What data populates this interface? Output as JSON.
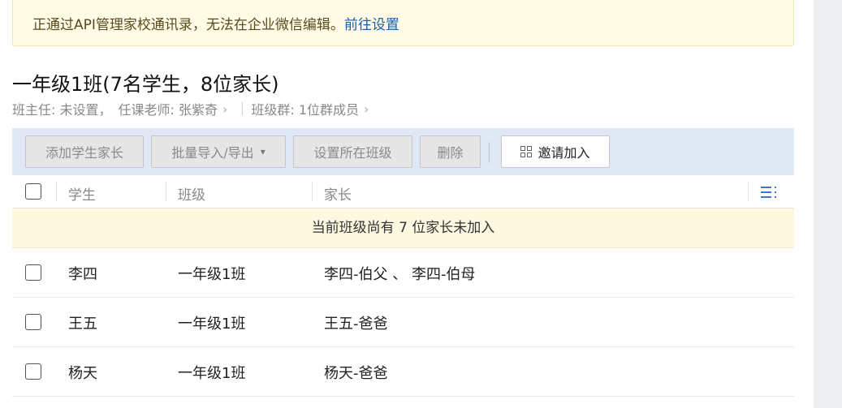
{
  "notice": {
    "text": "正通过API管理家校通讯录，无法在企业微信编辑。",
    "link": "前往设置"
  },
  "class_title": "一年级1班(7名学生，8位家长)",
  "subinfo": {
    "head_teacher": "班主任: 未设置，",
    "subject_teacher": "任课老师: 张紫奇",
    "class_group": "班级群: 1位群成员",
    "chevron": "›"
  },
  "toolbar": {
    "add_label": "添加学生家长",
    "import_export_label": "批量导入/导出",
    "caret": "▾",
    "set_class_label": "设置所在班级",
    "delete_label": "删除",
    "invite_label": "邀请加入"
  },
  "table": {
    "headers": {
      "student": "学生",
      "class": "班级",
      "parents": "家长"
    },
    "banner": "当前班级尚有 7 位家长未加入",
    "rows": [
      {
        "student": "李四",
        "class": "一年级1班",
        "parents": "李四-伯父 、 李四-伯母"
      },
      {
        "student": "王五",
        "class": "一年级1班",
        "parents": "王五-爸爸"
      },
      {
        "student": "杨天",
        "class": "一年级1班",
        "parents": "杨天-爸爸"
      }
    ]
  },
  "colors": {
    "toolbar_bg": "#dfe8f4",
    "notice_bg": "#fffbe6",
    "link": "#1a5fa8",
    "banner_bg": "#fdf8e0"
  },
  "icons": [
    "chevron-right-icon",
    "caret-down-icon",
    "qr-code-icon",
    "column-settings-icon"
  ]
}
